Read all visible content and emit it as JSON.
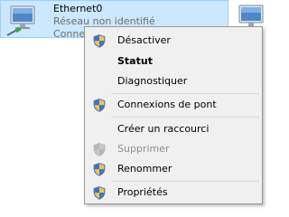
{
  "adapter": {
    "name": "Ethernet0",
    "status": "Réseau non identifié",
    "device": "Conne"
  },
  "menu": {
    "items": [
      {
        "label": "Désactiver",
        "icon": "uac-shield-icon",
        "bold": false,
        "disabled": false
      },
      {
        "label": "Statut",
        "icon": null,
        "bold": true,
        "disabled": false
      },
      {
        "label": "Diagnostiquer",
        "icon": null,
        "bold": false,
        "disabled": false
      },
      {
        "label": "Connexions de pont",
        "icon": "uac-shield-icon",
        "bold": false,
        "disabled": false
      },
      {
        "label": "Créer un raccourci",
        "icon": null,
        "bold": false,
        "disabled": false
      },
      {
        "label": "Supprimer",
        "icon": "uac-shield-icon",
        "bold": false,
        "disabled": true
      },
      {
        "label": "Renommer",
        "icon": "uac-shield-icon",
        "bold": false,
        "disabled": false
      },
      {
        "label": "Propriétés",
        "icon": "uac-shield-icon",
        "bold": false,
        "disabled": false
      }
    ]
  },
  "colors": {
    "selection": "#cce8ff",
    "selection_border": "#99d1ff",
    "menu_bg": "#f0f0f0",
    "menu_border": "#979797",
    "secondary_text": "#6d6d6d",
    "disabled_text": "#8f8f8f"
  }
}
